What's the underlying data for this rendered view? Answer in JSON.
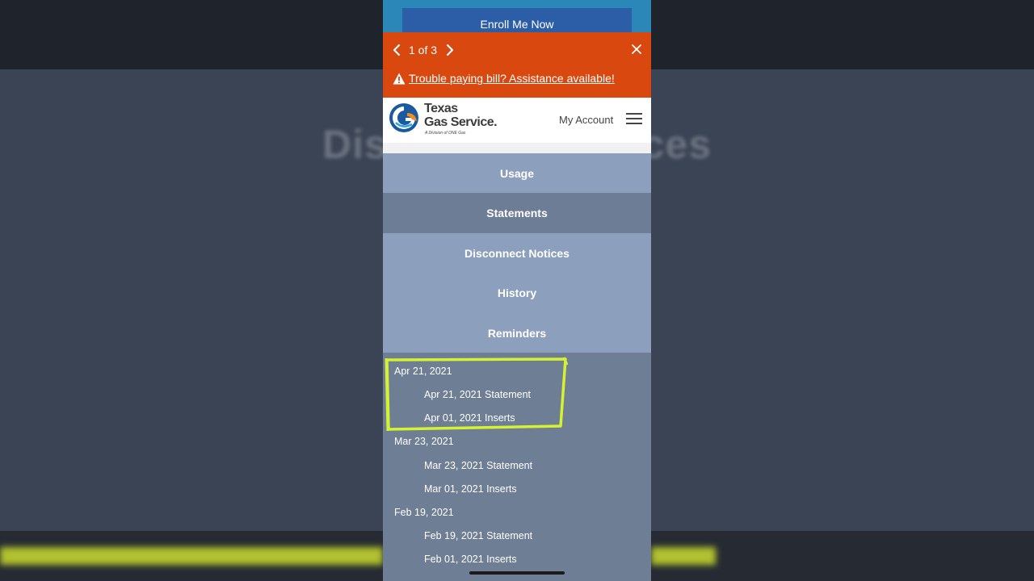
{
  "background": {
    "blurred_title": "Disconnect Notices"
  },
  "enroll": {
    "label": "Enroll Me Now"
  },
  "alert": {
    "pager": "1 of 3",
    "message": "Trouble paying bill? Assistance available!"
  },
  "header": {
    "logo_line1": "Texas",
    "logo_line2": "Gas Service.",
    "logo_tagline": "A Division of ONE Gas",
    "account_label": "My Account"
  },
  "tabs": [
    {
      "label": "Usage",
      "active": false
    },
    {
      "label": "Statements",
      "active": true
    },
    {
      "label": "Disconnect Notices",
      "active": false
    },
    {
      "label": "History",
      "active": false
    },
    {
      "label": "Reminders",
      "active": false
    }
  ],
  "statements": [
    {
      "date": "Apr 21, 2021",
      "items": [
        "Apr 21, 2021 Statement",
        "Apr 01, 2021 Inserts"
      ]
    },
    {
      "date": "Mar 23, 2021",
      "items": [
        "Mar 23, 2021 Statement",
        "Mar 01, 2021 Inserts"
      ]
    },
    {
      "date": "Feb 19, 2021",
      "items": [
        "Feb 19, 2021 Statement",
        "Feb 01, 2021 Inserts"
      ]
    }
  ],
  "colors": {
    "alert_bg": "#d9480f",
    "enroll_bar": "#2a87b8",
    "enroll_button": "#2c5ea8",
    "tab_bg": "#8c9fbd",
    "tab_active_bg": "#6c7d95",
    "content_bg": "#6e7e94",
    "highlight": "#d4f232"
  }
}
